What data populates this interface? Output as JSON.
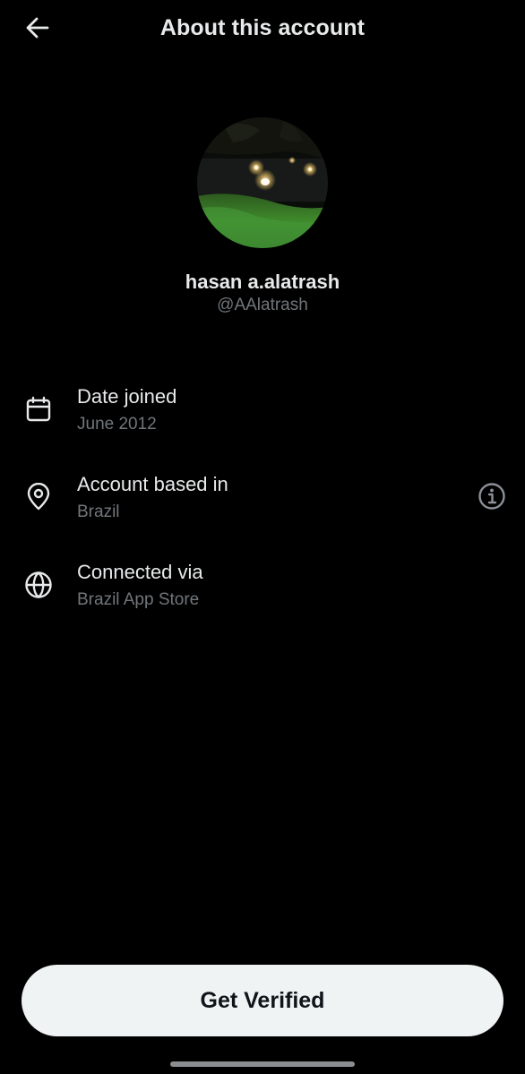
{
  "header": {
    "title": "About this account",
    "back_icon": "arrow-left-icon"
  },
  "profile": {
    "display_name": "hasan a.alatrash",
    "handle": "@AAlatrash"
  },
  "info_rows": [
    {
      "label": "Date joined",
      "value": "June 2012",
      "icon": "calendar-icon"
    },
    {
      "label": "Account based in",
      "value": "Brazil",
      "icon": "location-pin-icon",
      "trailing_icon": "info-icon"
    },
    {
      "label": "Connected via",
      "value": "Brazil App Store",
      "icon": "globe-icon"
    }
  ],
  "cta": {
    "label": "Get Verified"
  },
  "colors": {
    "background": "#000000",
    "primary_text": "#e7e9ea",
    "secondary_text": "#71767b",
    "button_bg": "#eff3f4",
    "button_text": "#0f1419"
  }
}
